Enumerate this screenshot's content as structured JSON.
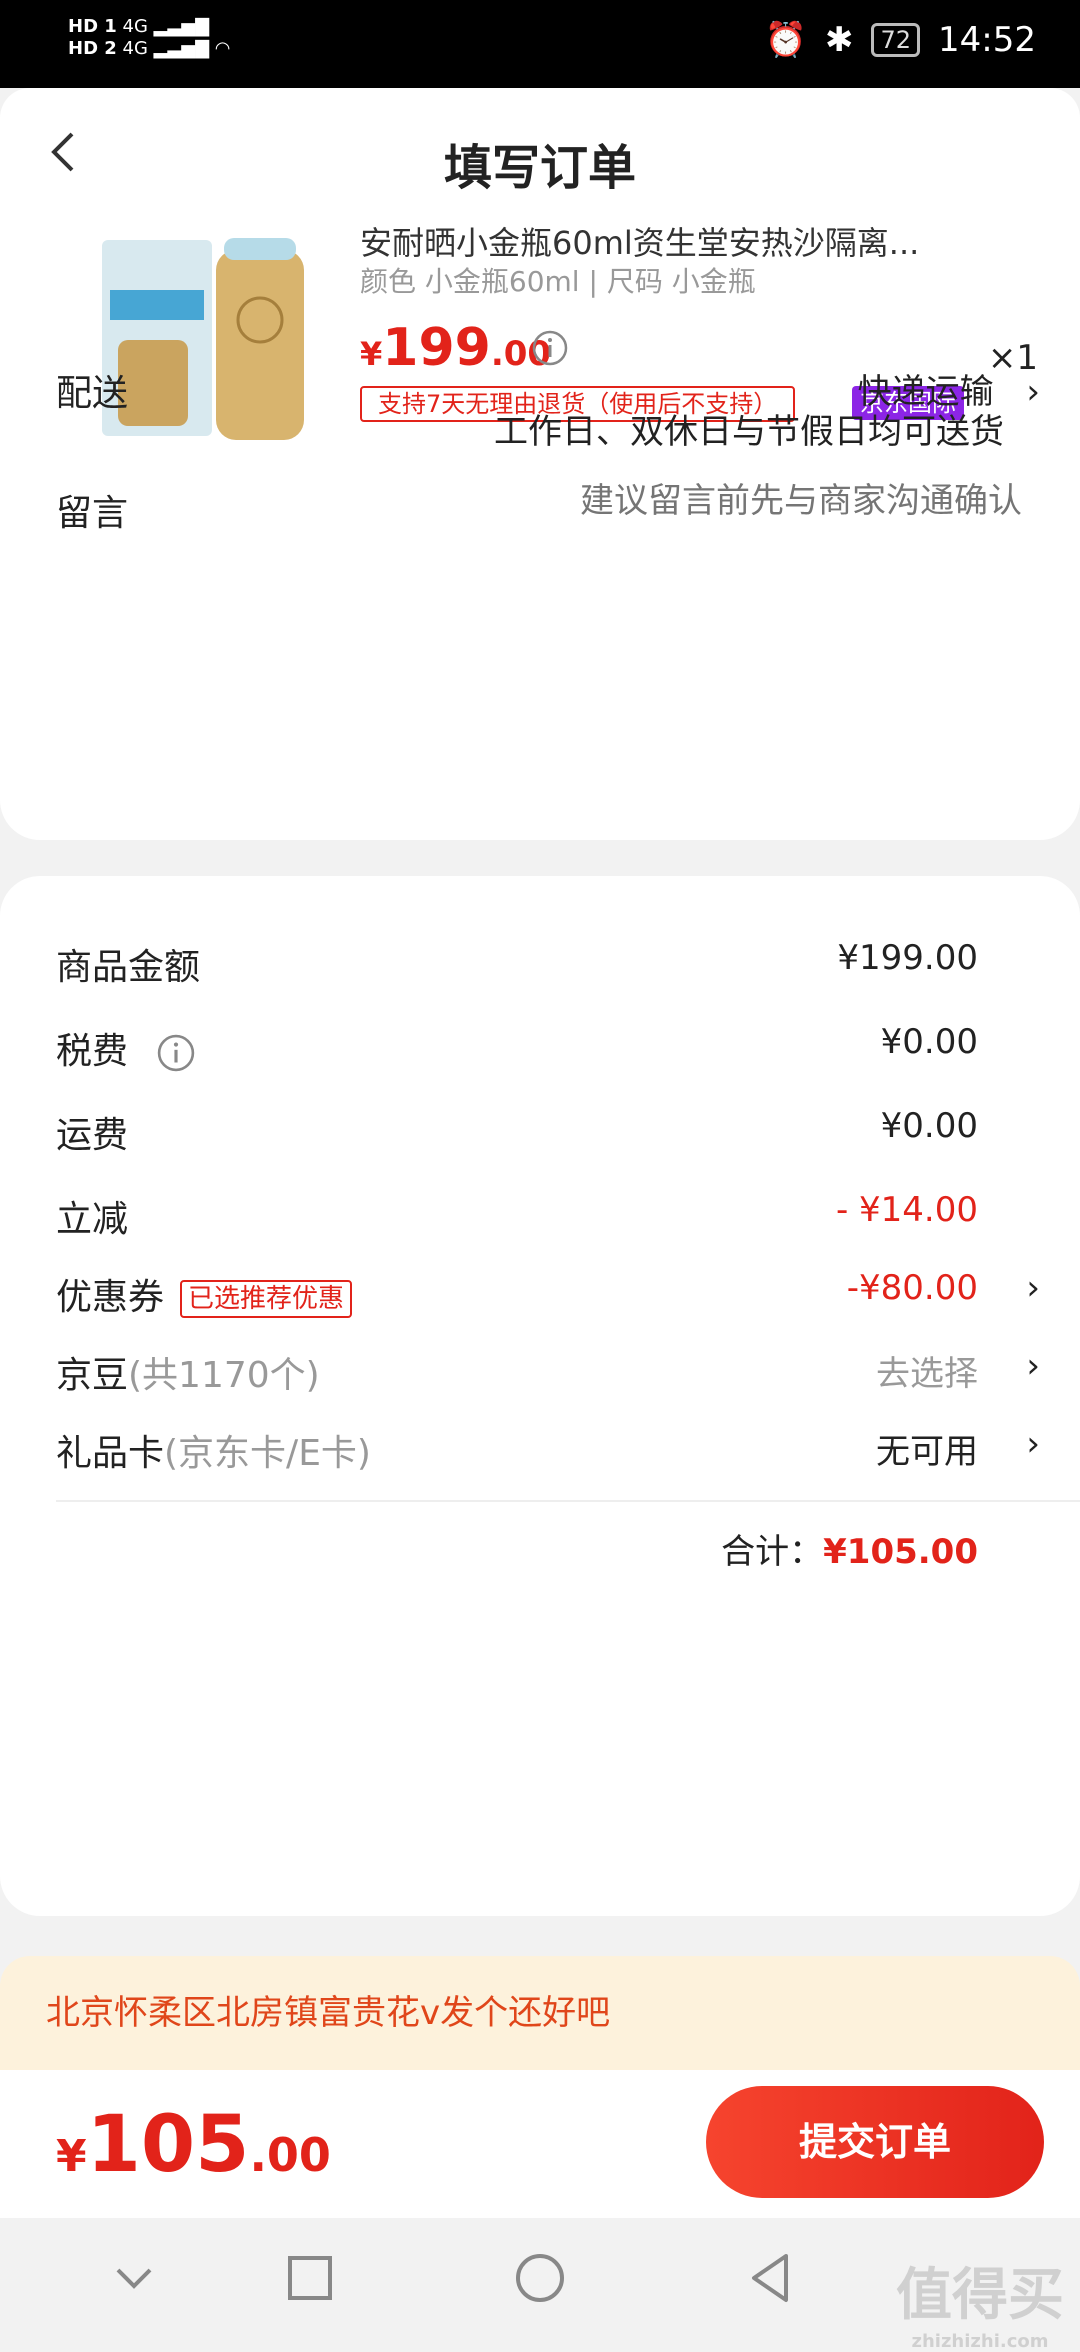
{
  "status_bar": {
    "signal_1": "HD 1",
    "signal_2": "HD 2",
    "net_1": "4G",
    "net_2": "4G",
    "battery": "72",
    "time": "14:52"
  },
  "header": {
    "title": "填写订单"
  },
  "product": {
    "title": "安耐晒小金瓶60ml资生堂安热沙隔离...",
    "spec": "颜色 小金瓶60ml | 尺码 小金瓶",
    "price_symbol": "¥",
    "price_int": "199",
    "price_dec": ".00",
    "quantity": "×1",
    "returns_tag": "支持7天无理由退货（使用后不支持）",
    "intl_tag": "京东国际"
  },
  "delivery": {
    "label": "配送",
    "method": "快递运输",
    "schedule": "工作日、双休日与节假日均可送货"
  },
  "message": {
    "label": "留言",
    "placeholder": "建议留言前先与商家沟通确认"
  },
  "summary": {
    "goods": {
      "label": "商品金额",
      "value": "¥199.00"
    },
    "tax": {
      "label": "税费",
      "value": "¥0.00"
    },
    "shipping": {
      "label": "运费",
      "value": "¥0.00"
    },
    "discount": {
      "label": "立减",
      "value": "- ¥14.00"
    },
    "coupon": {
      "label": "优惠券",
      "tag": "已选推荐优惠",
      "value": "-¥80.00"
    },
    "jingdou": {
      "label": "京豆",
      "sub": "(共1170个)",
      "value": "去选择"
    },
    "giftcard": {
      "label": "礼品卡",
      "sub": "(京东卡/E卡)",
      "value": "无可用"
    },
    "total_label": "合计：",
    "total_value": "¥105.00"
  },
  "address": {
    "text": "北京怀柔区北房镇富贵花v发个还好吧"
  },
  "bottom": {
    "price_symbol": "¥",
    "price_int": "105",
    "price_dec": ".00",
    "submit_label": "提交订单"
  },
  "watermark": {
    "text": "值得买",
    "sub": "zhizhizhi.com"
  },
  "colors": {
    "accent": "#e2231a",
    "intl": "#8c25e6",
    "address_bg": "#fdf2dc"
  }
}
